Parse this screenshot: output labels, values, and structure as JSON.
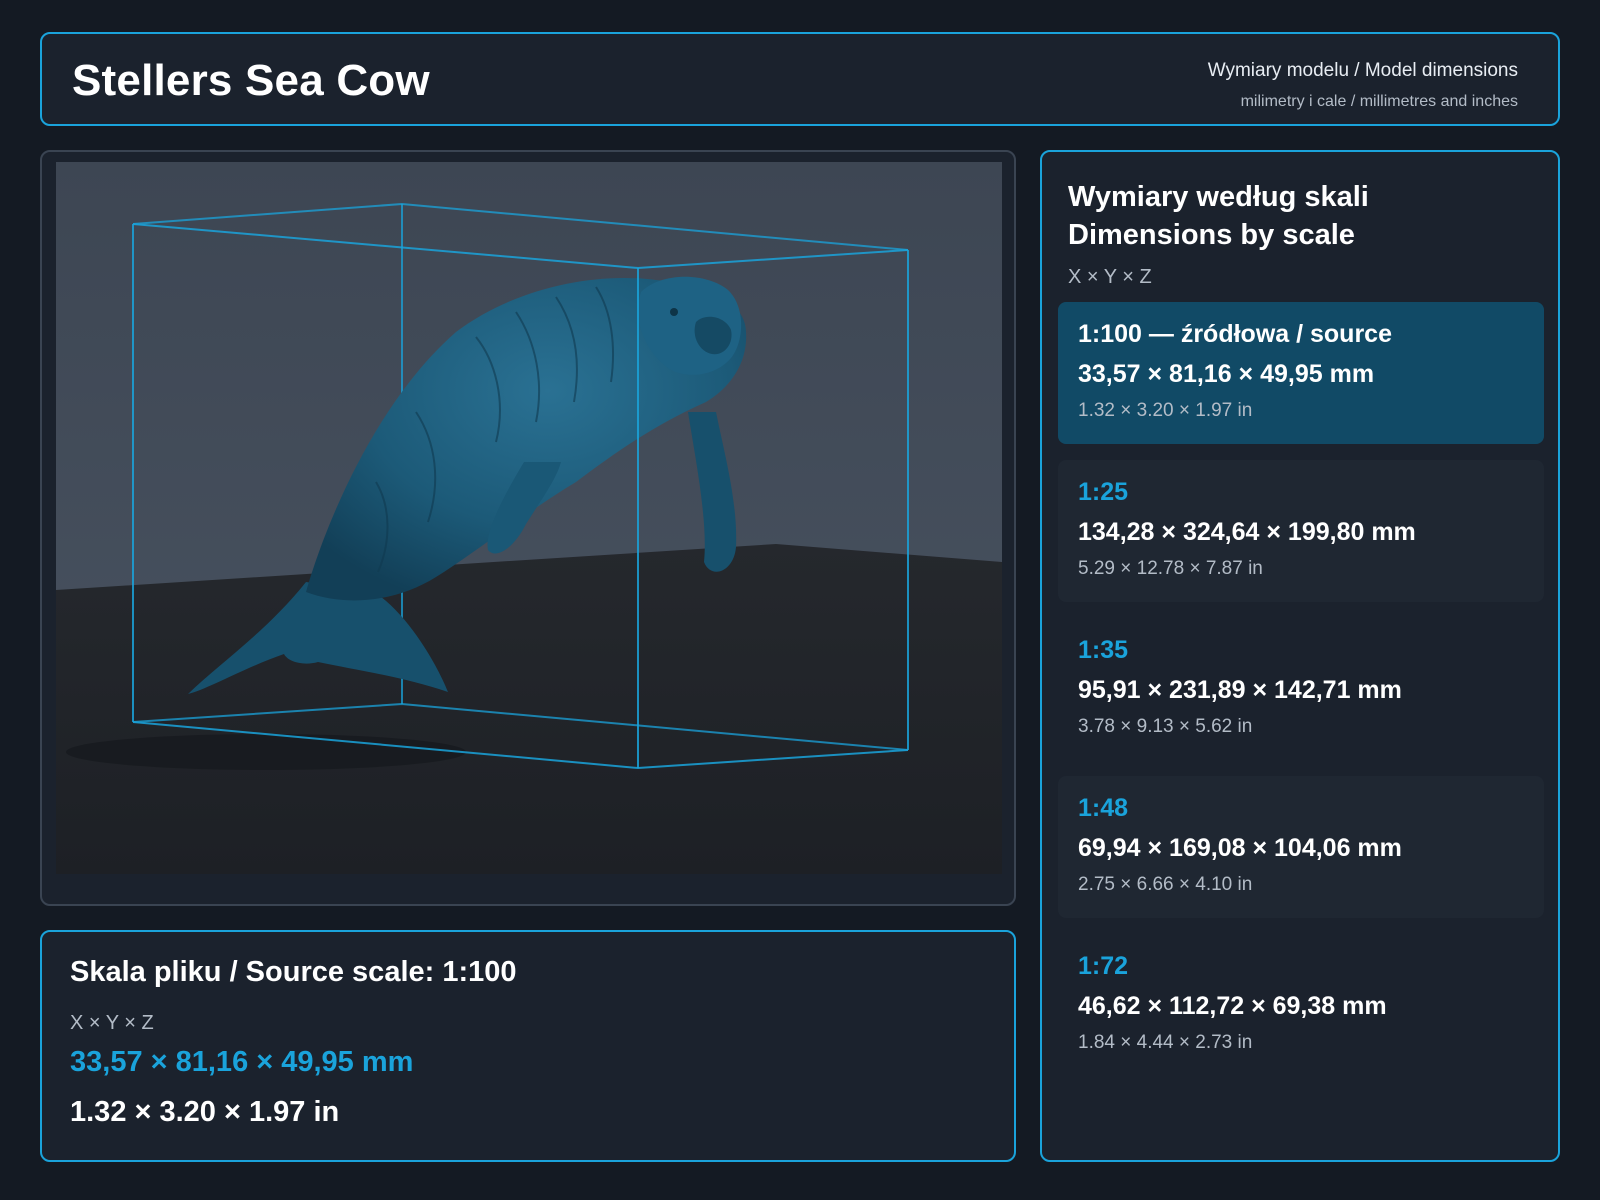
{
  "header": {
    "title": "Stellers Sea Cow",
    "subtitle": "Wymiary modelu / Model dimensions",
    "units_note": "milimetry i cale / millimetres and inches"
  },
  "viewer": {
    "model_color": "#1c5a78",
    "bbox_color": "#1aa3db"
  },
  "source": {
    "title": "Skala pliku / Source scale: 1:100",
    "axes": "X × Y × Z",
    "mm": "33,57 × 81,16 × 49,95 mm",
    "in": "1.32 × 3.20 × 1.97 in"
  },
  "scales": {
    "title_line1": "Wymiary według skali",
    "title_line2": "Dimensions by scale",
    "axes": "X × Y × Z",
    "items": [
      {
        "label": "1:100  —  źródłowa / source",
        "mm": "33,57 × 81,16 × 49,95 mm",
        "in": "1.32 × 3.20 × 1.97 in"
      },
      {
        "label": "1:25",
        "mm": "134,28 × 324,64 × 199,80 mm",
        "in": "5.29 × 12.78 × 7.87 in"
      },
      {
        "label": "1:35",
        "mm": "95,91 × 231,89 × 142,71 mm",
        "in": "3.78 × 9.13 × 5.62 in"
      },
      {
        "label": "1:48",
        "mm": "69,94 × 169,08 × 104,06 mm",
        "in": "2.75 × 6.66 × 4.10 in"
      },
      {
        "label": "1:72",
        "mm": "46,62 × 112,72 × 69,38 mm",
        "in": "1.84 × 4.44 × 2.73 in"
      }
    ]
  },
  "colors": {
    "accent": "#1aa3db",
    "background": "#141a23",
    "panel": "#1b222d",
    "active_card": "#114a66"
  }
}
